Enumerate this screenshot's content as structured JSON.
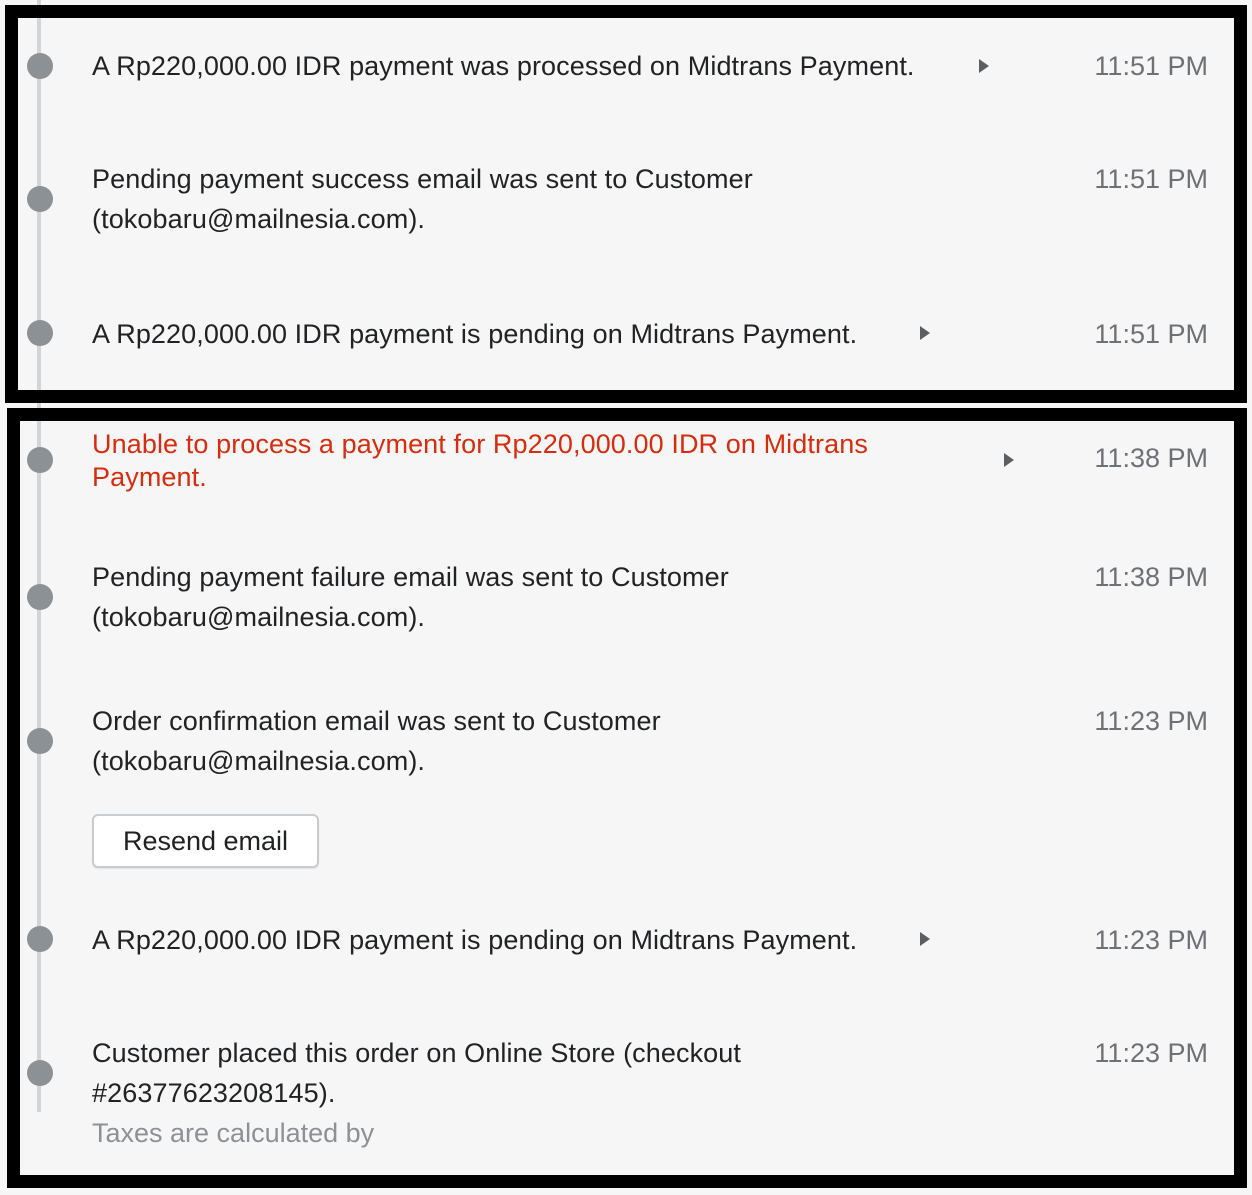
{
  "events": [
    {
      "text": "A Rp220,000.00 IDR payment was processed on Midtrans Payment.",
      "time": "11:51 PM",
      "expandable": true
    },
    {
      "text_line1": "Pending payment success email was sent to Customer",
      "text_line2": "(tokobaru@mailnesia.com).",
      "time": "11:51 PM"
    },
    {
      "text": "A Rp220,000.00 IDR payment is pending on Midtrans Payment.",
      "time": "11:51 PM",
      "expandable": true
    },
    {
      "text_line1": "Unable to process a payment for Rp220,000.00 IDR on Midtrans",
      "text_line2": "Payment.",
      "time": "11:38 PM",
      "expandable": true,
      "status": "error",
      "status_color": "#d72c0d"
    },
    {
      "text_line1": "Pending payment failure email was sent to Customer",
      "text_line2": "(tokobaru@mailnesia.com).",
      "time": "11:38 PM"
    },
    {
      "text_line1": "Order confirmation email was sent to Customer",
      "text_line2": "(tokobaru@mailnesia.com).",
      "time": "11:23 PM",
      "button_label": "Resend email"
    },
    {
      "text": "A Rp220,000.00 IDR payment is pending on Midtrans Payment.",
      "time": "11:23 PM",
      "expandable": true
    },
    {
      "text_line1": "Customer placed this order on Online Store (checkout",
      "text_line2": "#26377623208145).",
      "subtext": "Taxes are calculated by",
      "time": "11:23 PM"
    }
  ],
  "icons": {
    "expand": "caret-right-icon",
    "timeline_marker": "timeline-dot"
  },
  "colors": {
    "background": "#f6f6f7",
    "dot": "#8c9196",
    "error": "#d72c0d",
    "time": "#6d7175",
    "highlight_border": "#000000"
  }
}
